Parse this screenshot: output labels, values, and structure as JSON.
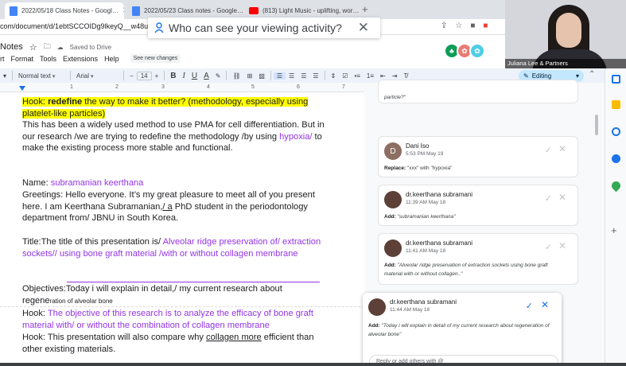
{
  "browser": {
    "tabs": [
      {
        "label": "2022/05/18 Class Notes - Googl…",
        "favicon": "docs-icon"
      },
      {
        "label": "2022/05/23 Class notes - Google…",
        "favicon": "docs-icon"
      },
      {
        "label": "(813) Light Music - uplifting, wor…",
        "favicon": "youtube-icon"
      }
    ],
    "tab_close": "✕",
    "new_tab": "+",
    "url": "com/document/d/1ebtSCCOIDg9lkeyQ__w48ucc"
  },
  "popup": {
    "text": "Who can see your viewing activity?",
    "close": "✕"
  },
  "doc": {
    "title": "Notes",
    "saved": "Saved to Drive",
    "menu": [
      "rt",
      "Format",
      "Tools",
      "Extensions",
      "Help"
    ],
    "see_changes": "See new changes"
  },
  "toolbar": {
    "style": "Normal text",
    "font": "Arial",
    "minus": "−",
    "size": "14",
    "plus": "+",
    "bold": "B",
    "italic": "I",
    "underline": "U",
    "text_color": "A",
    "mode": "Editing"
  },
  "ruler": {
    "ticks": [
      "1",
      "2",
      "3",
      "4",
      "5",
      "6",
      "7"
    ]
  },
  "document": {
    "hook1_a": "Hook: ",
    "hook1_b": "redefine",
    "hook1_c": " the way to make it better? (methodology, especially using platelet-like particles)",
    "p1_a": "This has been a widely used method to use PMA for cell differentiation. But in our research /we are trying to redefine the methodology /by using ",
    "p1_b": "hypoxia/",
    "p1_c": " to make the existing process more stable and functional.",
    "name_label": "Name: ",
    "name_value": "subramanian keerthana",
    "greet_a": "Greetings: Hello everyone. It’s my great pleasure to meet all of you present here. I am Keerthana Subramanian,",
    "greet_b": "/ a",
    "greet_c": " PhD student in the periodontology department from/ JBNU in South Korea.",
    "title_a": "Title:The title of this presentation is/  ",
    "title_b": "Alveolar ridge preservation of/ extraction sockets// using bone graft material /with or without collagen membrane",
    "obj_a": "Objectives:",
    "obj_b": "Today i will explain in detail,/ my current research about regene",
    "obj_c": "ration of alveolar bone",
    "hook2_a": "Hook: ",
    "hook2_b": "The objective of this research is to analyze the efficacy of bone graft material with/ or without the combination of collagen membrane",
    "hook3_a": "Hook: This presentation will also compare why ",
    "hook3_b": "collagen more",
    "hook3_c": " efficient than other existing materials."
  },
  "comments": {
    "top_fragment": "particle?\"",
    "items": [
      {
        "author": "Dani Iso",
        "time": "5:53 PM May 19",
        "label": "Replace:",
        "text": "\"xxx\" with \"hypoxia\"",
        "initial": "D"
      },
      {
        "author": "dr.keerthana subramani",
        "time": "11:39 AM May 18",
        "label": "Add:",
        "text": "\"subramanian keerthana\""
      },
      {
        "author": "dr.keerthana subramani",
        "time": "11:41 AM May 18",
        "label": "Add:",
        "text": "\"Alveolar ridge preservation of extraction sockets using bone graft material with or without collagen..\""
      },
      {
        "author": "dr.keerthana subramani",
        "time": "11:44 AM May 18",
        "label": "Add:",
        "text": "\"Today i will explain in detail of my current research about regeneration of alveolar bone\""
      }
    ],
    "check": "✓",
    "close": "✕",
    "reply_placeholder": "Reply or add others with @"
  },
  "webcam": {
    "name": "Juliana Lee & Partners"
  },
  "side_panel": {
    "add": "+"
  },
  "colors": {
    "highlight": "#ffff00",
    "suggestion": "#9334e6",
    "accent": "#1a73e8",
    "editing_chip": "#c2e7ff"
  }
}
